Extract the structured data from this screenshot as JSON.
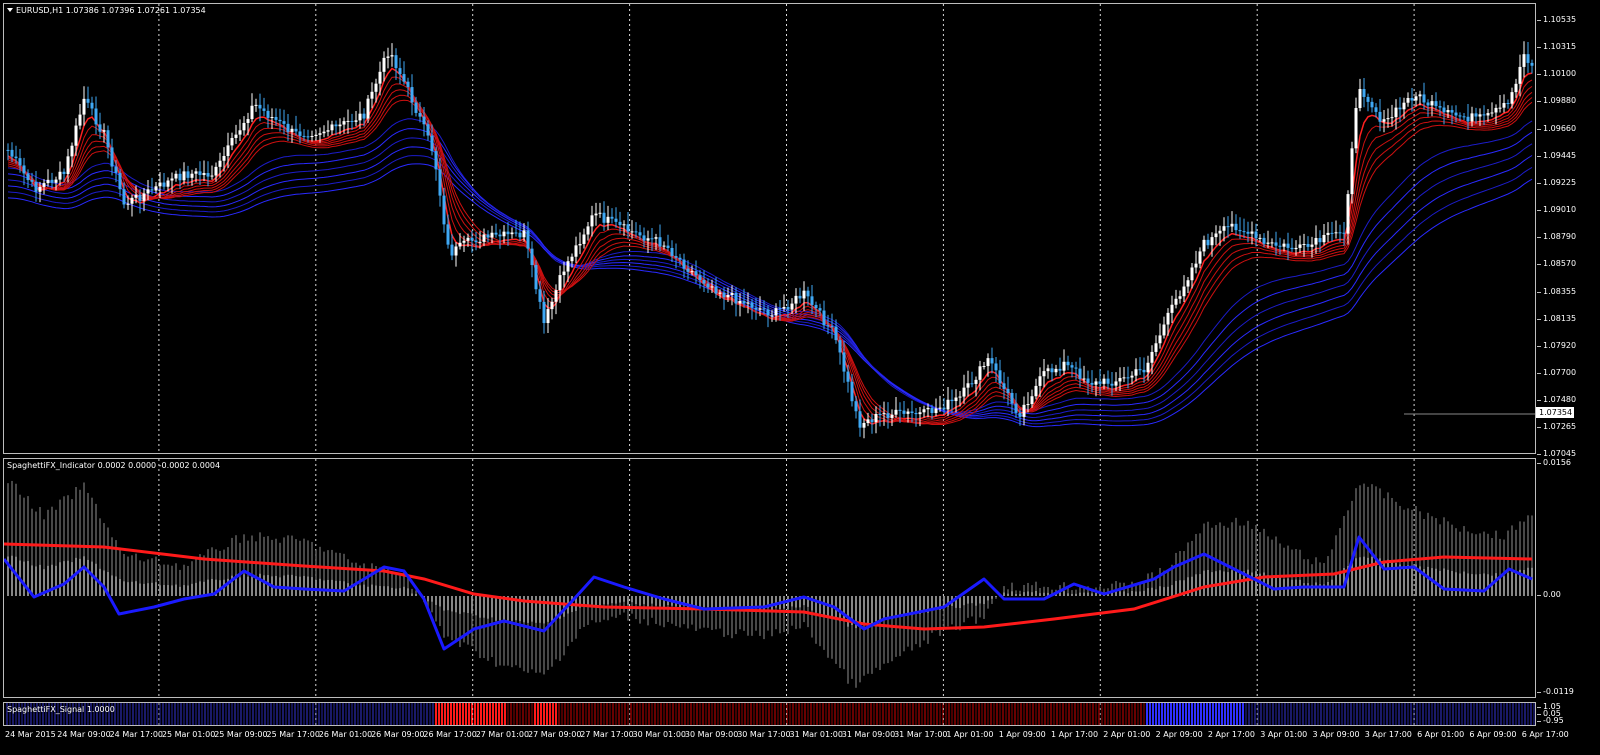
{
  "window": {
    "symbol_label": "EURUSD,H1  1.07386 1.07396 1.07261 1.07354"
  },
  "main_pane": {
    "price_scale": [
      "1.10535",
      "1.10315",
      "1.10100",
      "1.09880",
      "1.09660",
      "1.09445",
      "1.09225",
      "1.09010",
      "1.08790",
      "1.08570",
      "1.08355",
      "1.08135",
      "1.07920",
      "1.07700",
      "1.07480",
      "1.07265",
      "1.07045"
    ],
    "current_price": "1.07354",
    "colors": {
      "background": "#000000",
      "bull_candle": "#ffffff",
      "bear_candle": "#3fa9f5",
      "fast_ribbon": "#ff1a1a",
      "slow_ribbon": "#2424ff",
      "grid": "#ffffff"
    }
  },
  "indicator_pane": {
    "label": "SpaghettiFX_Indicator 0.0002 0.0000 -0.0002 0.0004",
    "scale": [
      "0.0156",
      "0.00",
      "-0.0119"
    ],
    "colors": {
      "histogram": "#808080",
      "signal_line": "#ff1a1a",
      "fast_line": "#1a1aff"
    }
  },
  "signal_pane": {
    "label": "SpaghettiFX_Signal 1.0000",
    "scale": [
      "1.05",
      "0.05",
      "-0.95"
    ],
    "colors": {
      "neutral": "#1a1a8a",
      "sell": "#ff1a1a",
      "sell_dim": "#8b0000",
      "buy": "#3030ff"
    }
  },
  "time_axis": {
    "labels": [
      "24 Mar 2015",
      "24 Mar 09:00",
      "24 Mar 17:00",
      "25 Mar 01:00",
      "25 Mar 09:00",
      "25 Mar 17:00",
      "26 Mar 01:00",
      "26 Mar 09:00",
      "26 Mar 17:00",
      "27 Mar 01:00",
      "27 Mar 09:00",
      "27 Mar 17:00",
      "30 Mar 01:00",
      "30 Mar 09:00",
      "30 Mar 17:00",
      "31 Mar 01:00",
      "31 Mar 09:00",
      "31 Mar 17:00",
      "1 Apr 01:00",
      "1 Apr 09:00",
      "1 Apr 17:00",
      "2 Apr 01:00",
      "2 Apr 09:00",
      "2 Apr 17:00",
      "3 Apr 01:00",
      "3 Apr 09:00",
      "3 Apr 17:00",
      "6 Apr 01:00",
      "6 Apr 09:00",
      "6 Apr 17:00"
    ]
  }
}
